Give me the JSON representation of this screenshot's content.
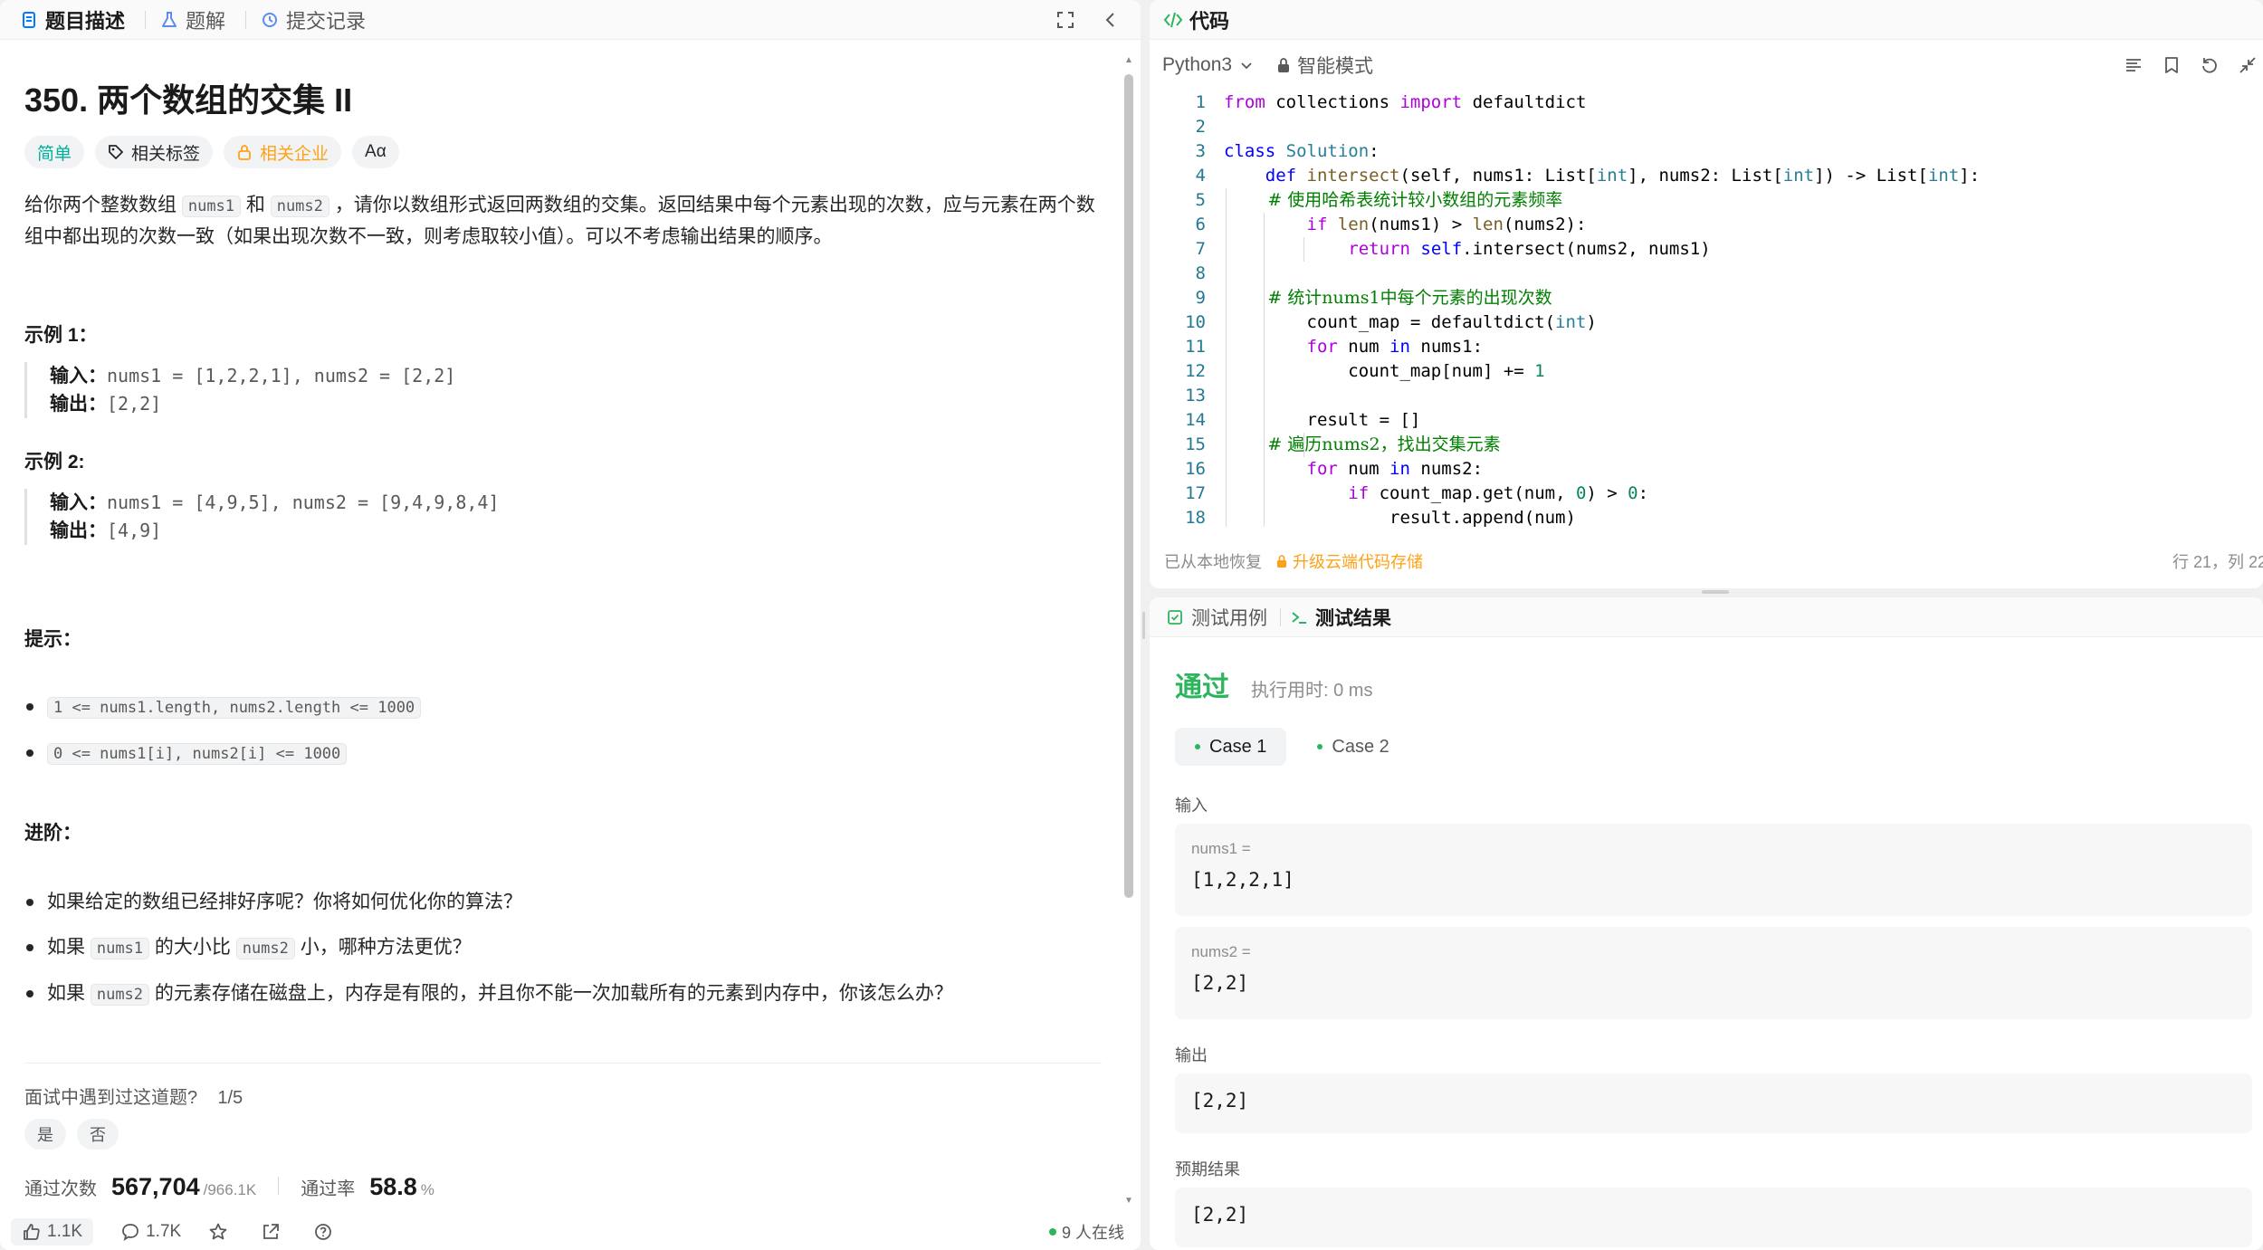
{
  "left_tabs": [
    {
      "label": "题目描述"
    },
    {
      "label": "题解"
    },
    {
      "label": "提交记录"
    }
  ],
  "problem": {
    "title": "350. 两个数组的交集 II",
    "tags": {
      "difficulty": "简单",
      "related_tags": "相关标签",
      "companies": "相关企业",
      "translate": "Aα"
    },
    "desc_p1": "给你两个整数数组 ",
    "desc_code1": "nums1",
    "desc_p2": " 和 ",
    "desc_code2": "nums2",
    "desc_p3": " ，请你以数组形式返回两数组的交集。返回结果中每个元素出现的次数，应与元素在两个数组中都出现的次数一致（如果出现次数不一致，则考虑取较小值）。可以不考虑输出结果的顺序。",
    "example1": {
      "heading": "示例 1：",
      "input_label": "输入：",
      "input": "nums1 = [1,2,2,1], nums2 = [2,2]",
      "output_label": "输出：",
      "output": "[2,2]"
    },
    "example2": {
      "heading": "示例 2:",
      "input_label": "输入：",
      "input": "nums1 = [4,9,5], nums2 = [9,4,9,8,4]",
      "output_label": "输出：",
      "output": "[4,9]"
    },
    "hints_heading": "提示：",
    "hints": [
      "1 <= nums1.length, nums2.length <= 1000",
      "0 <= nums1[i], nums2[i] <= 1000"
    ],
    "advanced_heading": "进阶：",
    "advanced": {
      "a1": "如果给定的数组已经排好序呢？你将如何优化你的算法？",
      "a2_pre": "如果 ",
      "a2_code1": "nums1",
      "a2_mid": " 的大小比 ",
      "a2_code2": "nums2",
      "a2_post": " 小，哪种方法更优？",
      "a3_pre": "如果 ",
      "a3_code": "nums2",
      "a3_post": " 的元素存储在磁盘上，内存是有限的，并且你不能一次加载所有的元素到内存中，你该怎么办？"
    },
    "interview_q": "面试中遇到过这道题?",
    "interview_count": "1/5",
    "yes": "是",
    "no": "否",
    "accepted_label": "通过次数",
    "accepted": "567,704",
    "submissions": "/966.1K",
    "rate_label": "通过率",
    "rate": "58.8",
    "rate_unit": "%"
  },
  "bottom_bar": {
    "likes": "1.1K",
    "comments": "1.7K",
    "online": "9 人在线"
  },
  "code": {
    "header": "代码",
    "language": "Python3",
    "mode": "智能模式",
    "restored": "已从本地恢复",
    "upgrade": "升级云端代码存储",
    "cursor": "行 21，列 22",
    "lines": [
      {
        "n": "1",
        "text": "from collections import defaultdict"
      },
      {
        "n": "2",
        "text": ""
      },
      {
        "n": "3",
        "text": "class Solution:"
      },
      {
        "n": "4",
        "text": "    def intersect(self, nums1: List[int], nums2: List[int]) -> List[int]:"
      },
      {
        "n": "5",
        "text": "        # 使用哈希表统计较小数组的元素频率"
      },
      {
        "n": "6",
        "text": "        if len(nums1) > len(nums2):"
      },
      {
        "n": "7",
        "text": "            return self.intersect(nums2, nums1)"
      },
      {
        "n": "8",
        "text": ""
      },
      {
        "n": "9",
        "text": "        # 统计nums1中每个元素的出现次数"
      },
      {
        "n": "10",
        "text": "        count_map = defaultdict(int)"
      },
      {
        "n": "11",
        "text": "        for num in nums1:"
      },
      {
        "n": "12",
        "text": "            count_map[num] += 1"
      },
      {
        "n": "13",
        "text": ""
      },
      {
        "n": "14",
        "text": "        result = []"
      },
      {
        "n": "15",
        "text": "        # 遍历nums2，找出交集元素"
      },
      {
        "n": "16",
        "text": "        for num in nums2:"
      },
      {
        "n": "17",
        "text": "            if count_map.get(num, 0) > 0:"
      },
      {
        "n": "18",
        "text": "                result.append(num)"
      }
    ]
  },
  "test": {
    "tab_cases": "测试用例",
    "tab_result": "测试结果",
    "status": "通过",
    "runtime": "执行用时: 0 ms",
    "cases": [
      "Case 1",
      "Case 2"
    ],
    "input_label": "输入",
    "var1": "nums1 =",
    "val1": "[1,2,2,1]",
    "var2": "nums2 =",
    "val2": "[2,2]",
    "output_label": "输出",
    "output": "[2,2]",
    "expected_label": "预期结果",
    "expected": "[2,2]"
  },
  "colors": {
    "accent_green": "#2db55d",
    "easy": "#00af9b",
    "orange": "#ffa116",
    "tab_blue": "#007aff"
  }
}
